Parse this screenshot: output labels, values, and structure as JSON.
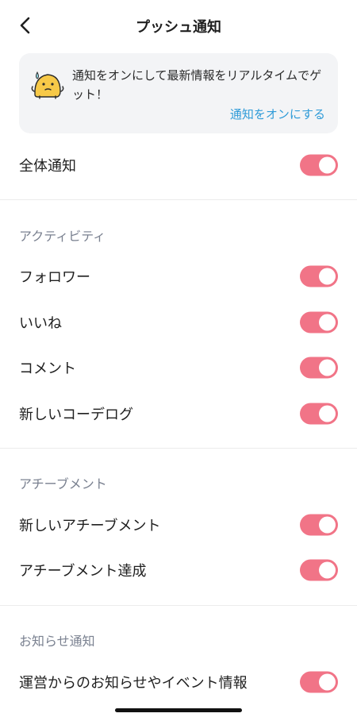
{
  "header": {
    "title": "プッシュ通知",
    "back_icon": "chevron-left-icon"
  },
  "banner": {
    "message": "通知をオンにして最新情報をリアルタイムでゲット！",
    "link_label": "通知をオンにする",
    "mascot_icon": "worried-mascot-icon",
    "link_color": "#2f9bd8"
  },
  "global": {
    "label": "全体通知",
    "enabled": true
  },
  "sections": {
    "activity": {
      "title": "アクティビティ",
      "items": [
        {
          "label": "フォロワー",
          "enabled": true
        },
        {
          "label": "いいね",
          "enabled": true
        },
        {
          "label": "コメント",
          "enabled": true
        },
        {
          "label": "新しいコーデログ",
          "enabled": true
        }
      ]
    },
    "achievement": {
      "title": "アチーブメント",
      "items": [
        {
          "label": "新しいアチーブメント",
          "enabled": true
        },
        {
          "label": "アチーブメント達成",
          "enabled": true
        }
      ]
    },
    "news": {
      "title": "お知らせ通知",
      "items": [
        {
          "label": "運営からのお知らせやイベント情報",
          "enabled": true
        }
      ]
    }
  },
  "colors": {
    "toggle_on": "#f17487",
    "section_title": "#7a8190",
    "banner_bg": "#f3f4f6"
  }
}
